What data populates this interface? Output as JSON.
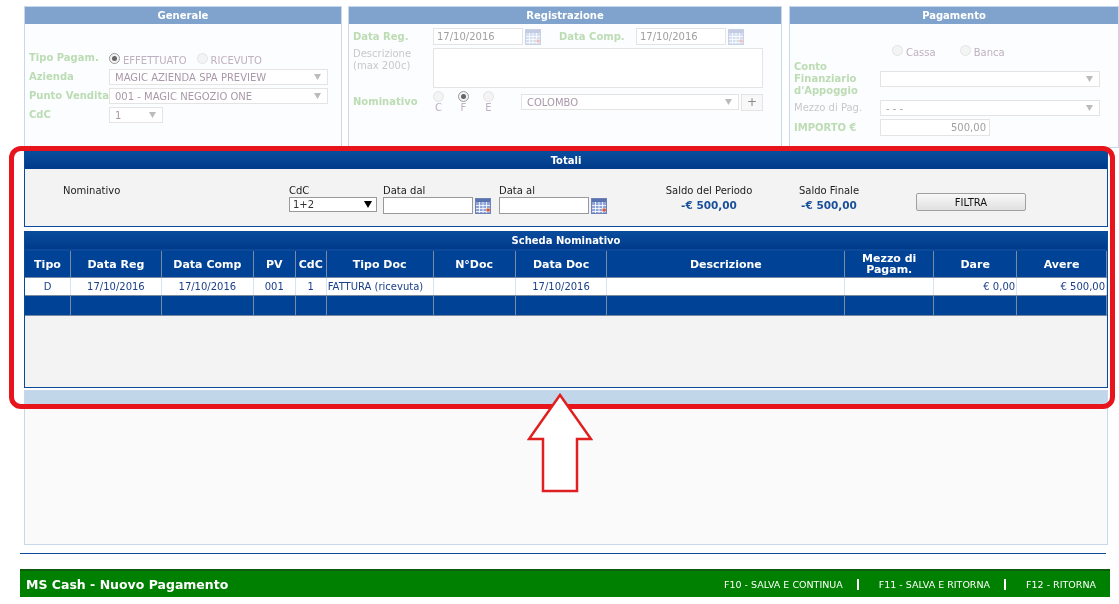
{
  "generale": {
    "title": "Generale",
    "tipo_pagam": {
      "label": "Tipo Pagam.",
      "options": [
        {
          "label": "EFFETTUATO",
          "selected": true
        },
        {
          "label": "RICEVUTO",
          "selected": false
        }
      ]
    },
    "fields": [
      {
        "label": "Azienda",
        "value": "MAGIC AZIENDA SPA PREVIEW"
      },
      {
        "label": "Punto Vendita",
        "value": "001 - MAGIC NEGOZIO ONE"
      }
    ],
    "cdc": {
      "label": "CdC",
      "value": "1"
    }
  },
  "registrazione": {
    "title": "Registrazione",
    "data_reg": {
      "label": "Data Reg.",
      "value": "17/10/2016"
    },
    "data_comp": {
      "label": "Data Comp.",
      "value": "17/10/2016"
    },
    "descrizione": {
      "label": "Descrizione (max 200c)"
    },
    "nominativo": {
      "label": "Nominativo",
      "options": [
        {
          "label": "C",
          "selected": false
        },
        {
          "label": "F",
          "selected": true
        },
        {
          "label": "E",
          "selected": false
        }
      ],
      "value": "COLOMBO",
      "add_button": "+"
    }
  },
  "pagamento": {
    "title": "Pagamento",
    "conto_tipo": [
      {
        "label": "Cassa",
        "selected": false
      },
      {
        "label": "Banca",
        "selected": false
      }
    ],
    "conto_finanziario": {
      "label": "Conto Finanziario d'Appoggio"
    },
    "mezzo": {
      "label": "Mezzo di Pag.",
      "value": "- - -"
    },
    "importo": {
      "label": "IMPORTO €",
      "value": "500,00"
    }
  },
  "totali": {
    "title": "Totali",
    "nominativo_label": "Nominativo",
    "cdc": {
      "label": "CdC",
      "value": "1+2"
    },
    "data_dal": {
      "label": "Data dal"
    },
    "data_al": {
      "label": "Data al"
    },
    "saldo_periodo": {
      "label": "Saldo del Periodo",
      "value": "-€ 500,00"
    },
    "saldo_finale": {
      "label": "Saldo Finale",
      "value": "-€ 500,00"
    },
    "filter_button": "FILTRA"
  },
  "scheda": {
    "title": "Scheda Nominativo",
    "columns": [
      "Tipo",
      "Data Reg",
      "Data Comp",
      "PV",
      "CdC",
      "Tipo Doc",
      "N°Doc",
      "Data Doc",
      "Descrizione",
      "Mezzo di Pagam.",
      "Dare",
      "Avere"
    ],
    "rows": [
      [
        "D",
        "17/10/2016",
        "17/10/2016",
        "001",
        "1",
        "FATTURA (ricevuta)",
        "",
        "17/10/2016",
        "",
        "",
        "€ 0,00",
        "€ 500,00"
      ]
    ]
  },
  "footer": {
    "title": "MS Cash - Nuovo Pagamento",
    "actions": [
      "F10 - SALVA E CONTINUA",
      "F11 - SALVA E RITORNA",
      "F12 - RITORNA"
    ]
  }
}
